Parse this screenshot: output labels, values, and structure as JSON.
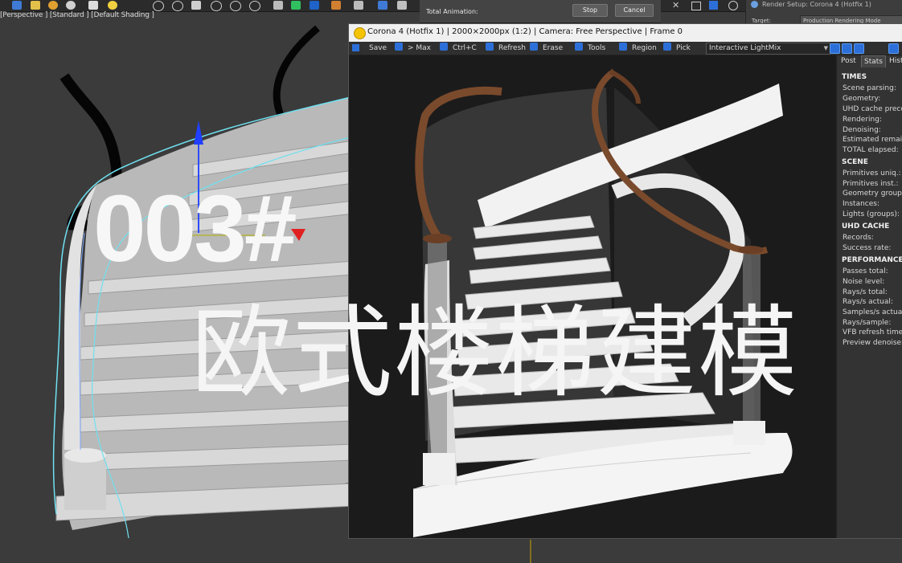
{
  "viewport": {
    "label": "[Perspective ] [Standard ] [Default Shading ]"
  },
  "animation_dialog": {
    "label": "Total Animation:",
    "stop_button": "Stop",
    "cancel_button": "Cancel"
  },
  "render_setup": {
    "title": "Render Setup: Corona 4 (Hotfix 1)",
    "target_label": "Target:",
    "target_value": "Production Rendering Mode"
  },
  "vfb": {
    "title": "Corona 4 (Hotfix 1) | 2000×2000px (1:2) | Camera: Free Perspective | Frame 0",
    "toolbar": {
      "save": "Save",
      "max": "> Max",
      "ctrlc": "Ctrl+C",
      "refresh": "Refresh",
      "erase": "Erase",
      "tools": "Tools",
      "region": "Region",
      "pick": "Pick"
    },
    "lightmix_dropdown": "Interactive LightMix"
  },
  "stats_panel": {
    "tabs": [
      "Post",
      "Stats",
      "Hist"
    ],
    "active_tab": "Stats",
    "times": {
      "heading": "TIMES",
      "rows": [
        "Scene parsing:",
        "Geometry:",
        "UHD cache preco",
        "Rendering:",
        "Denoising:",
        "Estimated remain",
        "TOTAL elapsed:"
      ]
    },
    "scene": {
      "heading": "SCENE",
      "rows": [
        "Primitives uniq.:",
        "Primitives inst.:",
        "Geometry groups",
        "Instances:",
        "Lights (groups):"
      ]
    },
    "uhd": {
      "heading": "UHD CACHE",
      "rows": [
        "Records:",
        "Success rate:"
      ]
    },
    "performance": {
      "heading": "PERFORMANCE",
      "rows": [
        "Passes total:",
        "Noise level:",
        "Rays/s total:",
        "Rays/s actual:",
        "Samples/s actual:",
        "Rays/sample:",
        "VFB refresh time:",
        "Preview denoiser"
      ]
    }
  },
  "overlay": {
    "number": "003#",
    "title": "欧式楼梯建模"
  },
  "colors": {
    "accent_blue": "#2d6fd8",
    "viewport_bg": "#3a3a3a",
    "render_bg": "#1c1c1c",
    "handrail": "#7a4a2c",
    "selection_cyan": "#6fe0f0"
  }
}
